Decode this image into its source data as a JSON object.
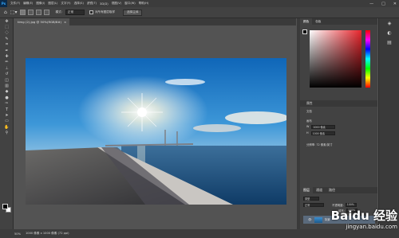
{
  "app": {
    "logo": "Ps"
  },
  "menu": [
    "文件(F)",
    "编辑(E)",
    "图像(I)",
    "图层(L)",
    "文字(Y)",
    "选择(S)",
    "滤镜(T)",
    "3D(D)",
    "视图(V)",
    "窗口(W)",
    "帮助(H)"
  ],
  "window_buttons": [
    "—",
    "□",
    "✕"
  ],
  "options": {
    "mode_label": "模式:",
    "mode_value": "正常",
    "sample_all_layers": "对所有图层取样",
    "select_subject": "选择主体"
  },
  "tab": {
    "title": "timg (2).jpg @ 50%(RGB/8#)",
    "close": "×"
  },
  "status": {
    "zoom": "50%",
    "doc_info": "1000 像素 x 1000 像素 (72 ppi)"
  },
  "panels": {
    "color_tabs": [
      "颜色",
      "色板"
    ],
    "props_tab": "属性",
    "props_subtitle": "文档",
    "canvas_title": "画布",
    "width_label": "W",
    "width_value": "1000 像素",
    "height_label": "H",
    "height_value": "1000 像素",
    "resolution": "分辨率: 72 像素/英寸",
    "layer_tabs": [
      "图层",
      "通道",
      "路径"
    ],
    "layer_kind": "类型",
    "blend_mode": "正常",
    "opacity_label": "不透明度:",
    "opacity_value": "100%",
    "fill_label": "填充:",
    "fill_value": "100%",
    "layer_name": "背景"
  },
  "watermark": {
    "main": "Baidu 经验",
    "sub": "jingyan.baidu.com"
  },
  "colors": {
    "accent": "#31a8ff",
    "panel": "#424242",
    "canvas": "#535353"
  },
  "icons": [
    "home-icon",
    "move-icon",
    "marquee-icon",
    "lasso-icon",
    "quick-select-icon",
    "crop-icon",
    "eyedropper-icon",
    "heal-icon",
    "brush-icon",
    "stamp-icon",
    "history-brush-icon",
    "eraser-icon",
    "gradient-icon",
    "blur-icon",
    "dodge-icon",
    "pen-icon",
    "type-icon",
    "path-select-icon",
    "shape-icon",
    "hand-icon",
    "zoom-icon"
  ]
}
